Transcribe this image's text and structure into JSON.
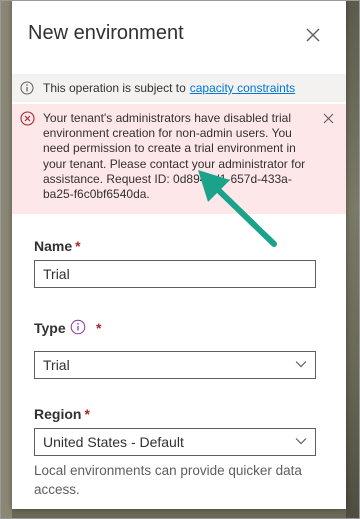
{
  "panel": {
    "title": "New environment",
    "close_icon": "close-icon"
  },
  "info_bar": {
    "text": "This operation is subject to",
    "link": "capacity constraints",
    "icon": "info-icon"
  },
  "error_bar": {
    "text": "Your tenant's administrators have disabled trial environment creation for non-admin users. You need permission to create a trial environment in your tenant. Please contact your administrator for assistance. Request ID: 0d894ad1-657d-433a-ba25-f6c0bf6540da.",
    "icon": "error-icon",
    "dismiss_icon": "dismiss-icon"
  },
  "form": {
    "name": {
      "label": "Name",
      "required": "*",
      "value": "Trial"
    },
    "type": {
      "label": "Type",
      "required": "*",
      "value": "Trial",
      "info_icon": "info-icon"
    },
    "region": {
      "label": "Region",
      "required": "*",
      "value": "United States - Default",
      "hint": "Local environments can provide quicker data access."
    }
  },
  "colors": {
    "accent": "#0078d4",
    "error_bg": "#fde7e9",
    "error_icon": "#a4262c",
    "info_bg": "#f3f2f1",
    "annotation_arrow": "#1aa38a"
  }
}
